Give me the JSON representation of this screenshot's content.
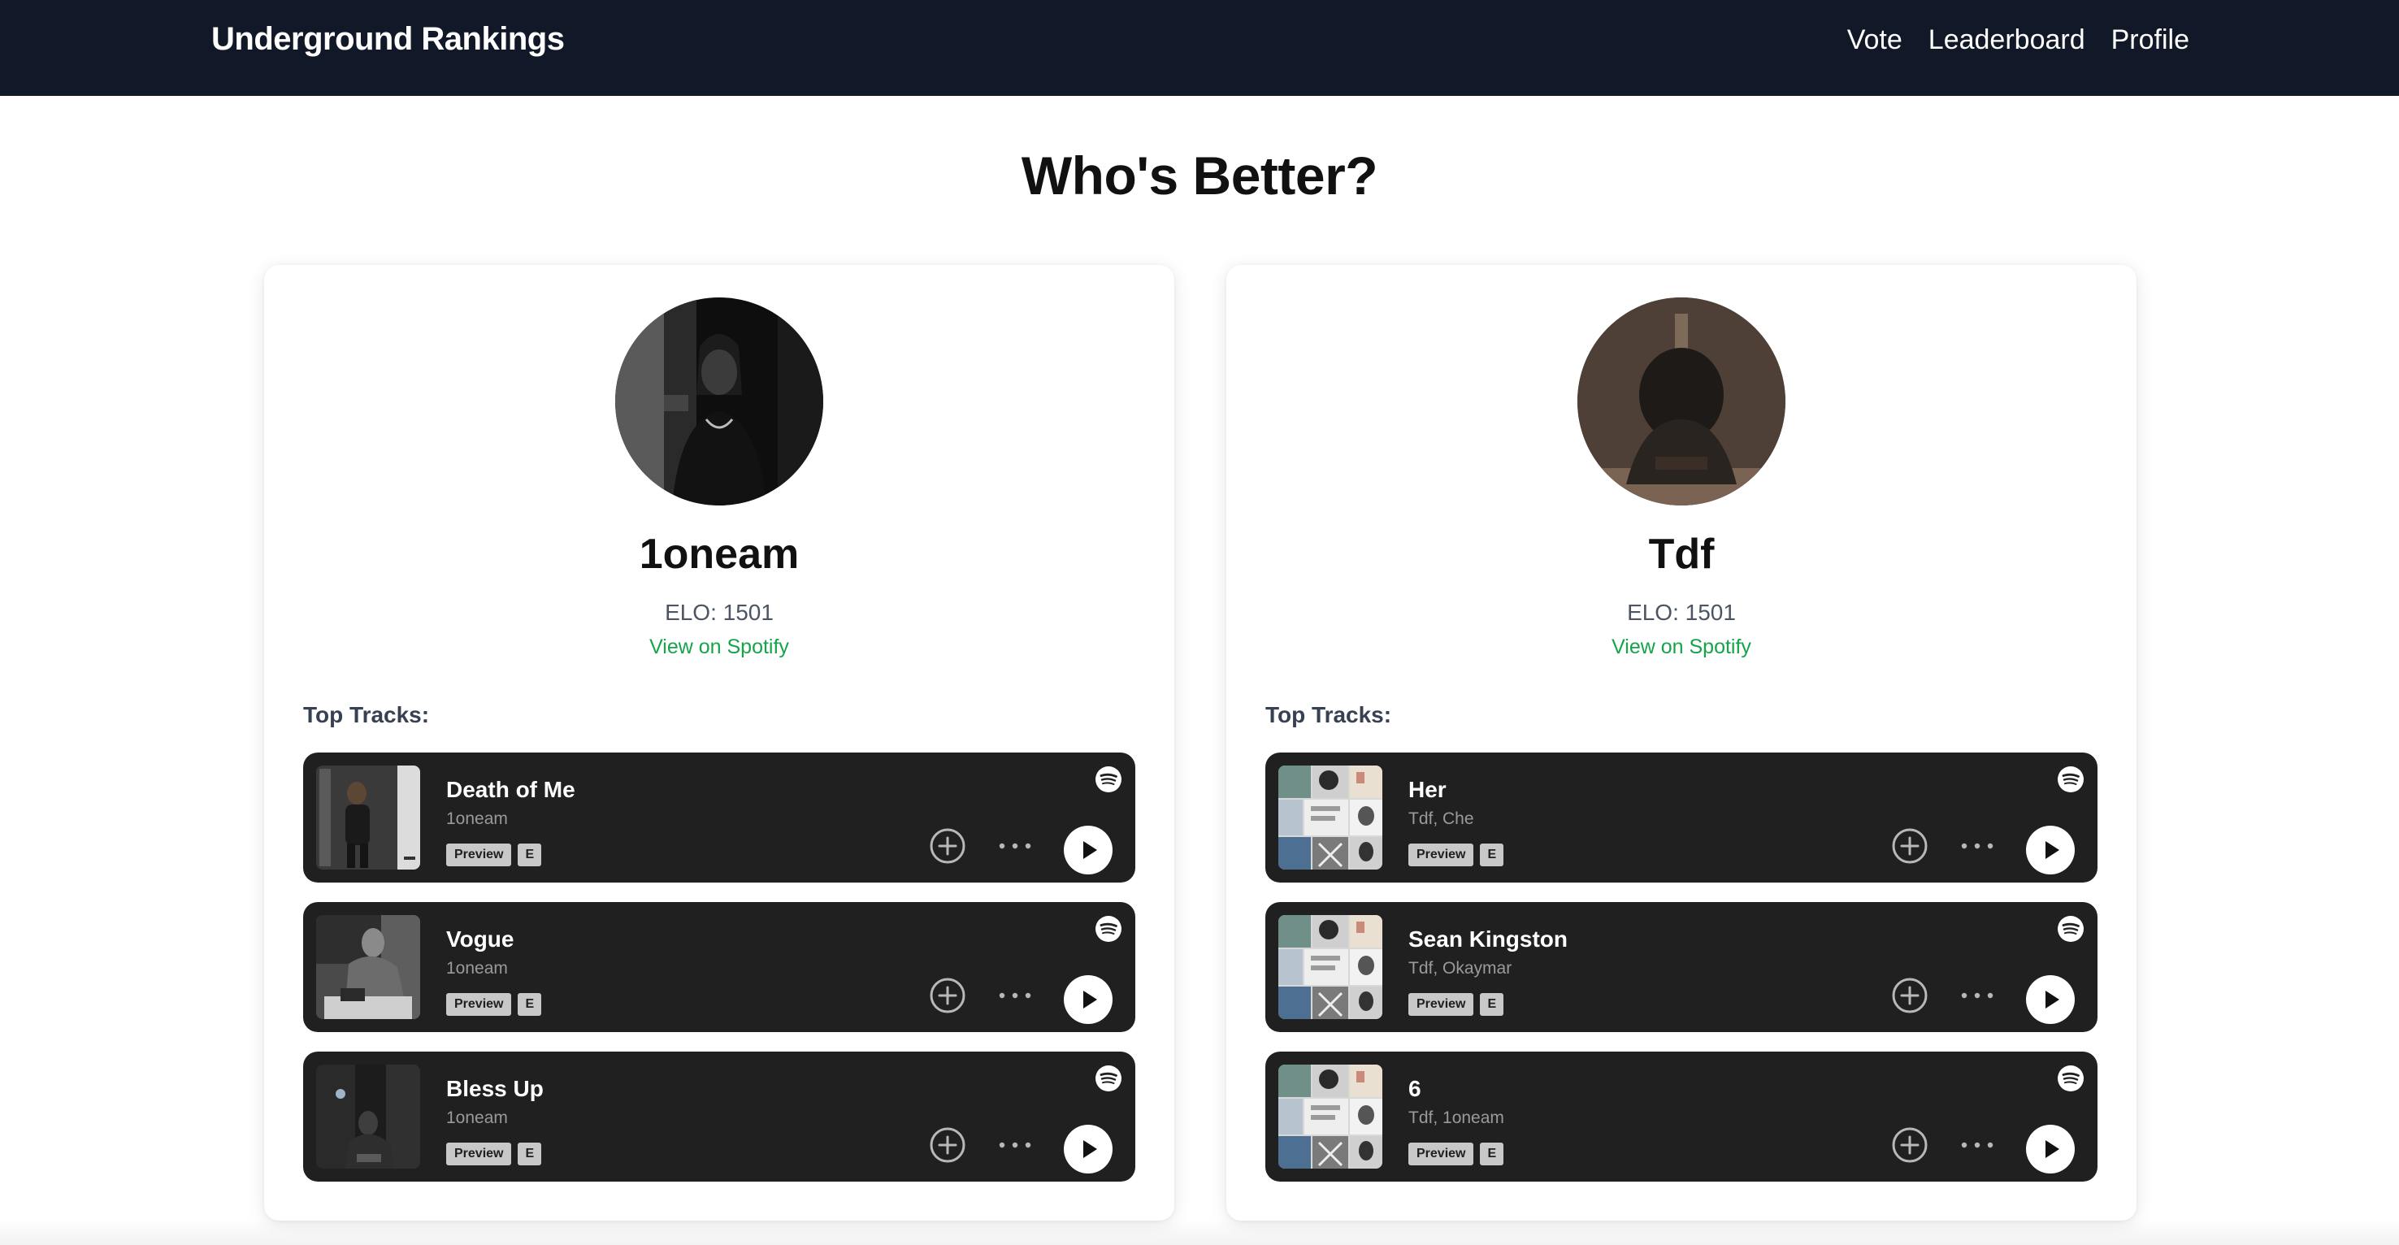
{
  "app": {
    "title": "Underground Rankings"
  },
  "nav": [
    {
      "label": "Vote"
    },
    {
      "label": "Leaderboard"
    },
    {
      "label": "Profile"
    }
  ],
  "headline": "Who's Better?",
  "colors": {
    "navbar": "#111827",
    "spotify_green": "#16a34a",
    "track_card": "#202020"
  },
  "artists": [
    {
      "name": "1oneam",
      "elo": "ELO: 1501",
      "spotify_link": "View on Spotify",
      "top_tracks_label": "Top Tracks:",
      "tracks": [
        {
          "title": "Death of Me",
          "artists": "1oneam",
          "preview": "Preview",
          "explicit": "E"
        },
        {
          "title": "Vogue",
          "artists": "1oneam",
          "preview": "Preview",
          "explicit": "E"
        },
        {
          "title": "Bless Up",
          "artists": "1oneam",
          "preview": "Preview",
          "explicit": "E"
        }
      ]
    },
    {
      "name": "Tdf",
      "elo": "ELO: 1501",
      "spotify_link": "View on Spotify",
      "top_tracks_label": "Top Tracks:",
      "tracks": [
        {
          "title": "Her",
          "artists": "Tdf, Che",
          "preview": "Preview",
          "explicit": "E"
        },
        {
          "title": "Sean Kingston",
          "artists": "Tdf, Okaymar",
          "preview": "Preview",
          "explicit": "E"
        },
        {
          "title": "6",
          "artists": "Tdf, 1oneam",
          "preview": "Preview",
          "explicit": "E"
        }
      ]
    }
  ],
  "icons": {
    "spotify": "spotify-logo-icon",
    "add": "plus-circle-icon",
    "more": "more-horizontal-icon",
    "play": "play-icon"
  }
}
